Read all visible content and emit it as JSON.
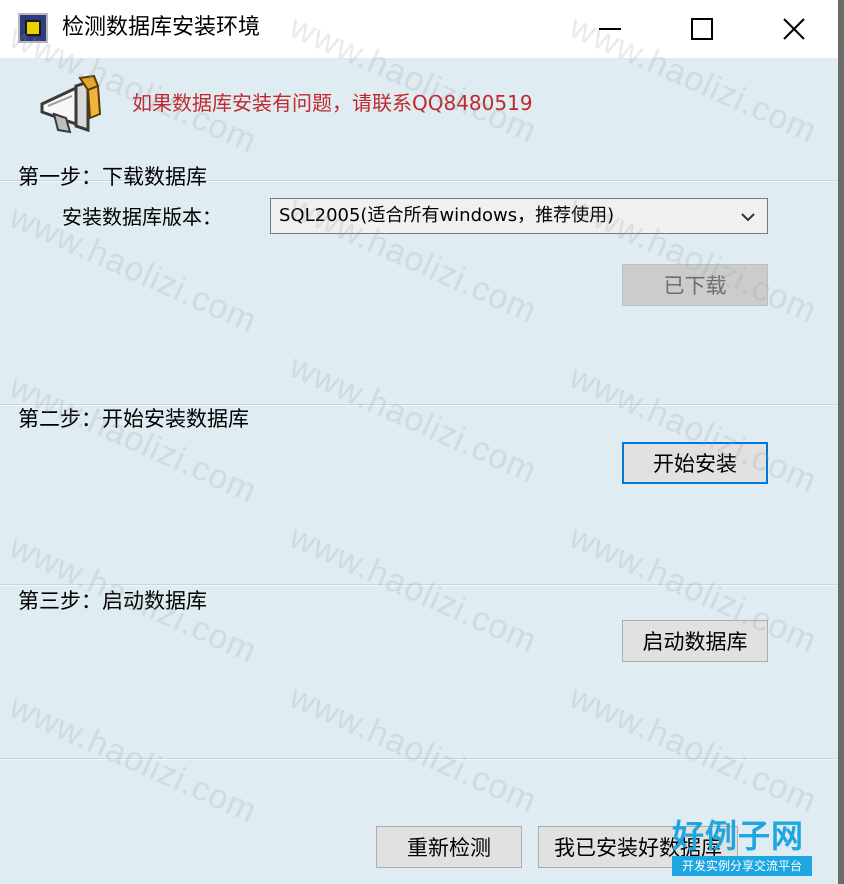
{
  "window": {
    "title": "检测数据库安装环境"
  },
  "titlebar": {
    "min_icon": "minimize-icon",
    "max_icon": "maximize-icon",
    "close_icon": "close-icon"
  },
  "header": {
    "contact_text": "如果数据库安装有问题，请联系QQ8480519",
    "icon": "megaphone-icon",
    "contact_color": "#c0282c"
  },
  "step1": {
    "title": "第一步：下载数据库",
    "version_label": "安装数据库版本：",
    "version_selected": "SQL2005(适合所有windows，推荐使用)",
    "download_button": "已下载"
  },
  "step2": {
    "title": "第二步：开始安装数据库",
    "install_button": "开始安装"
  },
  "step3": {
    "title": "第三步：启动数据库",
    "start_button": "启动数据库"
  },
  "footer": {
    "recheck_button": "重新检测",
    "installed_button": "我已安装好数据库"
  },
  "watermark": {
    "text": "www.haolizi.com"
  },
  "logo": {
    "main": "好例子网",
    "sub": "开发实例分享交流平台",
    "color": "#1da6e0"
  }
}
